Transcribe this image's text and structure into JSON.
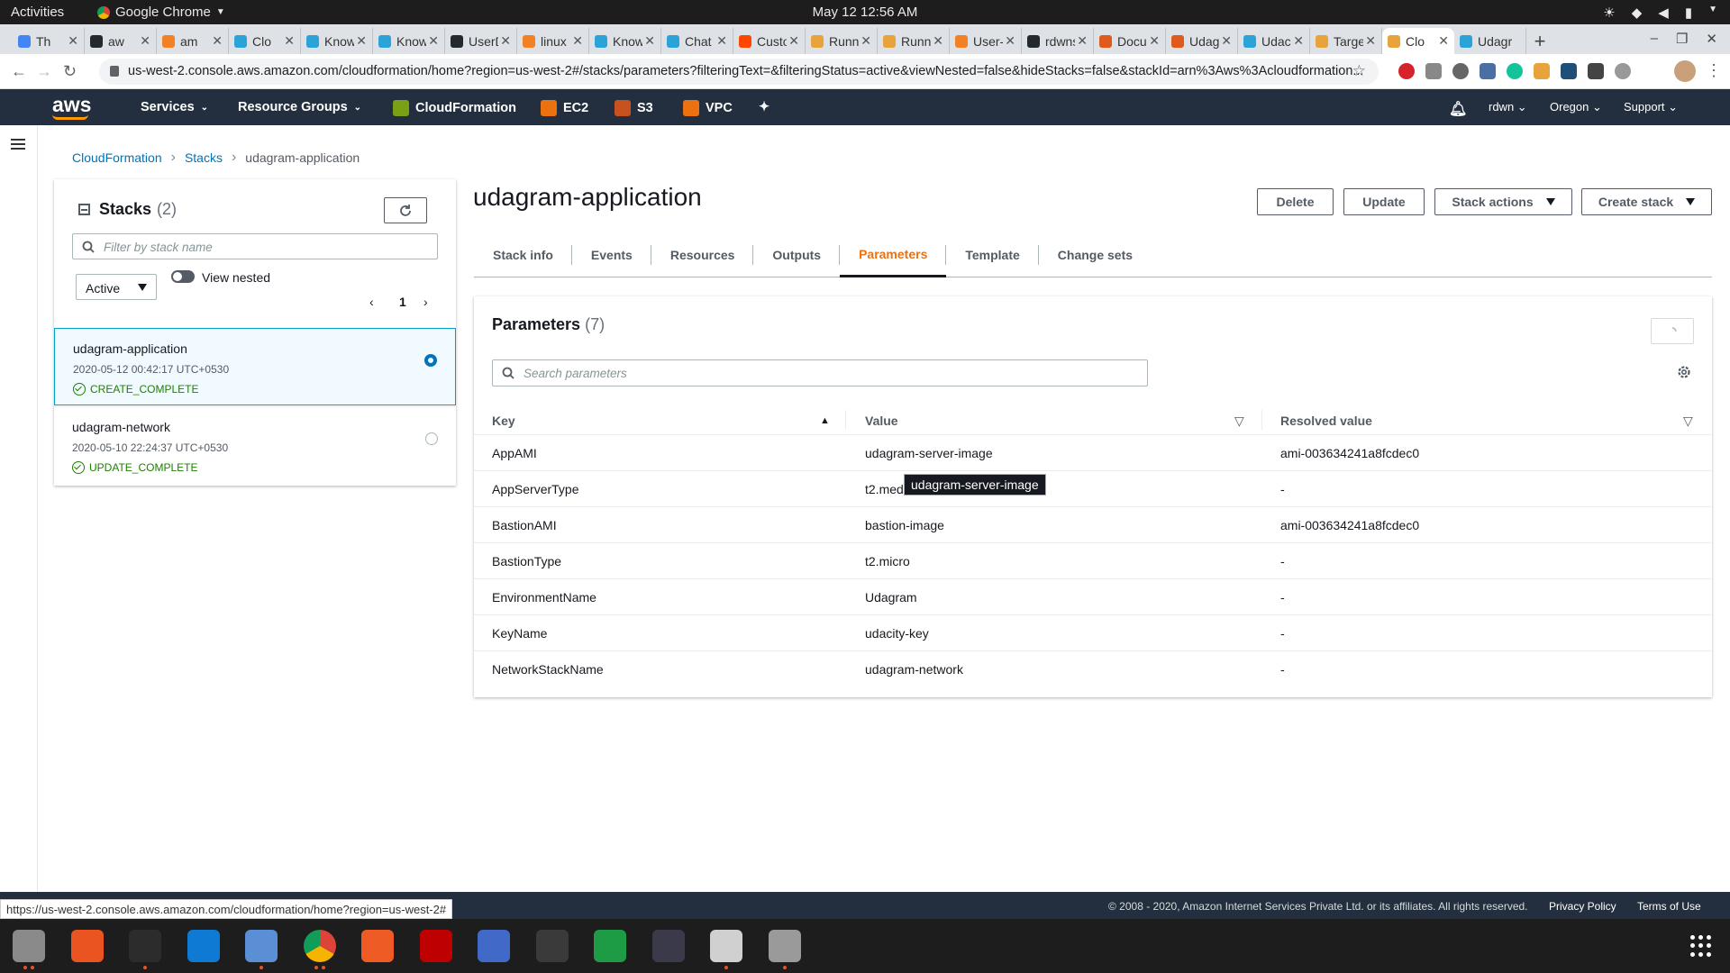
{
  "os": {
    "activities": "Activities",
    "app_name": "Google Chrome",
    "clock": "May 12  12:56 AM"
  },
  "browser": {
    "tabs": [
      {
        "title": "Th",
        "color": "#4285f4",
        "active": false
      },
      {
        "title": "aw",
        "color": "#24292e",
        "active": false
      },
      {
        "title": "am",
        "color": "#f48024",
        "active": false
      },
      {
        "title": "Clo",
        "color": "#2aa3d8",
        "active": false
      },
      {
        "title": "Know",
        "color": "#2aa3d8",
        "active": false
      },
      {
        "title": "Know",
        "color": "#2aa3d8",
        "active": false
      },
      {
        "title": "UserD",
        "color": "#24292e",
        "active": false
      },
      {
        "title": "linux -",
        "color": "#f48024",
        "active": false
      },
      {
        "title": "Know",
        "color": "#2aa3d8",
        "active": false
      },
      {
        "title": "Chat -",
        "color": "#2aa3d8",
        "active": false
      },
      {
        "title": "Custo",
        "color": "#ff4500",
        "active": false
      },
      {
        "title": "Runni",
        "color": "#e8a33d",
        "active": false
      },
      {
        "title": "Runni",
        "color": "#e8a33d",
        "active": false
      },
      {
        "title": "User-c",
        "color": "#f48024",
        "active": false
      },
      {
        "title": "rdwns",
        "color": "#24292e",
        "active": false
      },
      {
        "title": "Docur",
        "color": "#e05a1c",
        "active": false
      },
      {
        "title": "Udagr",
        "color": "#e05a1c",
        "active": false
      },
      {
        "title": "Udacit",
        "color": "#2aa3d8",
        "active": false
      },
      {
        "title": "Target",
        "color": "#e8a33d",
        "active": false
      },
      {
        "title": "Clo",
        "color": "#e8a33d",
        "active": true
      },
      {
        "title": "Udagr",
        "color": "#2aa3d8",
        "active": false
      }
    ],
    "url": "us-west-2.console.aws.amazon.com/cloudformation/home?region=us-west-2#/stacks/parameters?filteringText=&filteringStatus=active&viewNested=false&hideStacks=false&stackId=arn%3Aws%3Acloudformation...",
    "status_url": "https://us-west-2.console.aws.amazon.com/cloudformation/home?region=us-west-2#"
  },
  "aws_nav": {
    "logo": "aws",
    "services": "Services",
    "resource_groups": "Resource Groups",
    "pinned": [
      {
        "label": "CloudFormation",
        "color": "#7aa116"
      },
      {
        "label": "EC2",
        "color": "#ec7211"
      },
      {
        "label": "S3",
        "color": "#c7511f"
      },
      {
        "label": "VPC",
        "color": "#ec7211"
      }
    ],
    "user": "rdwn",
    "region": "Oregon",
    "support": "Support"
  },
  "breadcrumb": {
    "items": [
      "CloudFormation",
      "Stacks"
    ],
    "current": "udagram-application"
  },
  "stacks_panel": {
    "title": "Stacks",
    "count": "(2)",
    "filter_placeholder": "Filter by stack name",
    "status_filter": "Active",
    "view_nested": "View nested",
    "page": "1",
    "stacks": [
      {
        "name": "udagram-application",
        "date": "2020-05-12 00:42:17 UTC+0530",
        "status": "CREATE_COMPLETE",
        "selected": true
      },
      {
        "name": "udagram-network",
        "date": "2020-05-10 22:24:37 UTC+0530",
        "status": "UPDATE_COMPLETE",
        "selected": false
      }
    ]
  },
  "detail": {
    "title": "udagram-application",
    "buttons": {
      "delete": "Delete",
      "update": "Update",
      "stack_actions": "Stack actions",
      "create_stack": "Create stack"
    },
    "tabs": [
      "Stack info",
      "Events",
      "Resources",
      "Outputs",
      "Parameters",
      "Template",
      "Change sets"
    ],
    "active_tab": "Parameters"
  },
  "parameters": {
    "title": "Parameters",
    "count": "(7)",
    "search_placeholder": "Search parameters",
    "columns": [
      "Key",
      "Value",
      "Resolved value"
    ],
    "rows": [
      {
        "key": "AppAMI",
        "value": "udagram-server-image",
        "resolved": "ami-003634241a8fcdec0"
      },
      {
        "key": "AppServerType",
        "value": "t2.medium",
        "resolved": "-"
      },
      {
        "key": "BastionAMI",
        "value": "bastion-image",
        "resolved": "ami-003634241a8fcdec0"
      },
      {
        "key": "BastionType",
        "value": "t2.micro",
        "resolved": "-"
      },
      {
        "key": "EnvironmentName",
        "value": "Udagram",
        "resolved": "-"
      },
      {
        "key": "KeyName",
        "value": "udacity-key",
        "resolved": "-"
      },
      {
        "key": "NetworkStackName",
        "value": "udagram-network",
        "resolved": "-"
      }
    ],
    "tooltip": "udagram-server-image"
  },
  "footer": {
    "copyright": "© 2008 - 2020, Amazon Internet Services Private Ltd. or its affiliates. All rights reserved.",
    "privacy": "Privacy Policy",
    "terms": "Terms of Use"
  },
  "dock": [
    {
      "name": "files",
      "color": "#8a8a8a"
    },
    {
      "name": "software",
      "color": "#e95420"
    },
    {
      "name": "terminal",
      "color": "#2c2c2c"
    },
    {
      "name": "vscode",
      "color": "#0e7ad3"
    },
    {
      "name": "text-editor",
      "color": "#5a8fd6"
    },
    {
      "name": "chrome",
      "color": "#3b3b3b"
    },
    {
      "name": "postman",
      "color": "#ef5b25"
    },
    {
      "name": "filezilla",
      "color": "#bf0000"
    },
    {
      "name": "screenshot",
      "color": "#4169c7"
    },
    {
      "name": "calculator",
      "color": "#3a3a3a"
    },
    {
      "name": "spreadsheet",
      "color": "#1e9b45"
    },
    {
      "name": "bluetooth",
      "color": "#3a3a4a"
    },
    {
      "name": "document-viewer",
      "color": "#d0d0d0"
    },
    {
      "name": "disk",
      "color": "#9a9a9a"
    }
  ]
}
